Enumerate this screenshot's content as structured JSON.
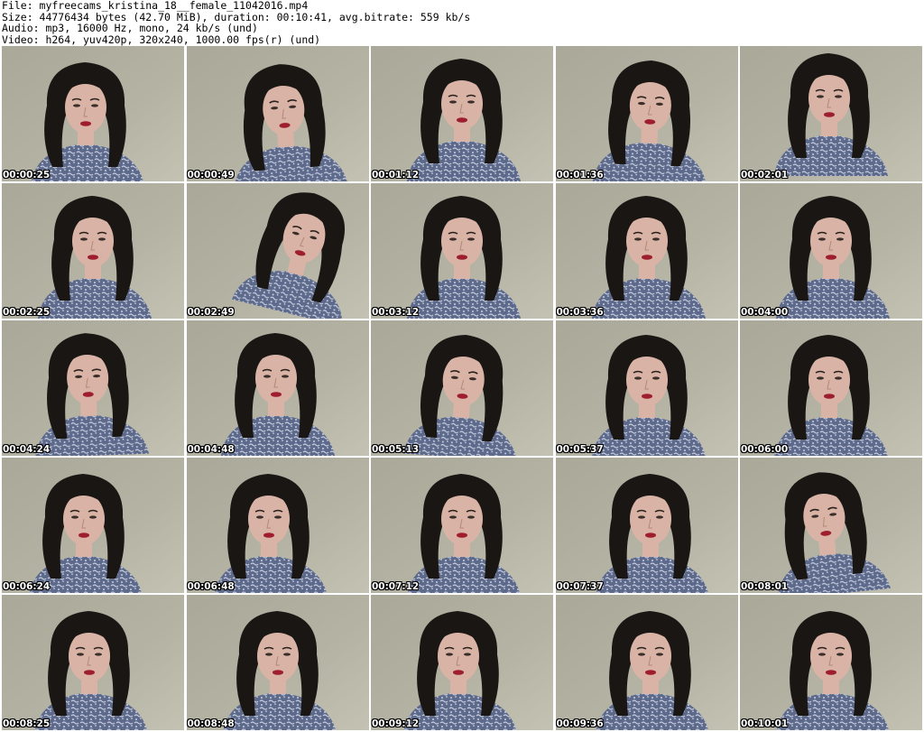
{
  "header": {
    "file_line": "File: myfreecams_kristina_18__female_11042016.mp4",
    "size_line": "Size: 44776434 bytes (42.70 MiB), duration: 00:10:41, avg.bitrate: 559 kb/s",
    "audio_line": "Audio: mp3, 16000 Hz, mono, 24 kb/s (und)",
    "video_line": "Video: h264, yuv420p, 320x240, 1000.00 fps(r) (und)"
  },
  "thumbnails": [
    {
      "timestamp": "00:00:25"
    },
    {
      "timestamp": "00:00:49"
    },
    {
      "timestamp": "00:01:12"
    },
    {
      "timestamp": "00:01:36"
    },
    {
      "timestamp": "00:02:01"
    },
    {
      "timestamp": "00:02:25"
    },
    {
      "timestamp": "00:02:49"
    },
    {
      "timestamp": "00:03:12"
    },
    {
      "timestamp": "00:03:36"
    },
    {
      "timestamp": "00:04:00"
    },
    {
      "timestamp": "00:04:24"
    },
    {
      "timestamp": "00:04:48"
    },
    {
      "timestamp": "00:05:13"
    },
    {
      "timestamp": "00:05:37"
    },
    {
      "timestamp": "00:06:00"
    },
    {
      "timestamp": "00:06:24"
    },
    {
      "timestamp": "00:06:48"
    },
    {
      "timestamp": "00:07:12"
    },
    {
      "timestamp": "00:07:37"
    },
    {
      "timestamp": "00:08:01"
    },
    {
      "timestamp": "00:08:25"
    },
    {
      "timestamp": "00:08:48"
    },
    {
      "timestamp": "00:09:12"
    },
    {
      "timestamp": "00:09:36"
    },
    {
      "timestamp": "00:10:01"
    }
  ],
  "colors": {
    "background_wall": "#b5b3a3",
    "hair": "#1a1614",
    "skin": "#d9b4a6",
    "lips": "#9e1e2e",
    "sweater": "#5d6a8c",
    "sweater_pattern": "#c9cfdf",
    "timestamp_text": "#ffffff",
    "timestamp_outline": "#000000"
  }
}
